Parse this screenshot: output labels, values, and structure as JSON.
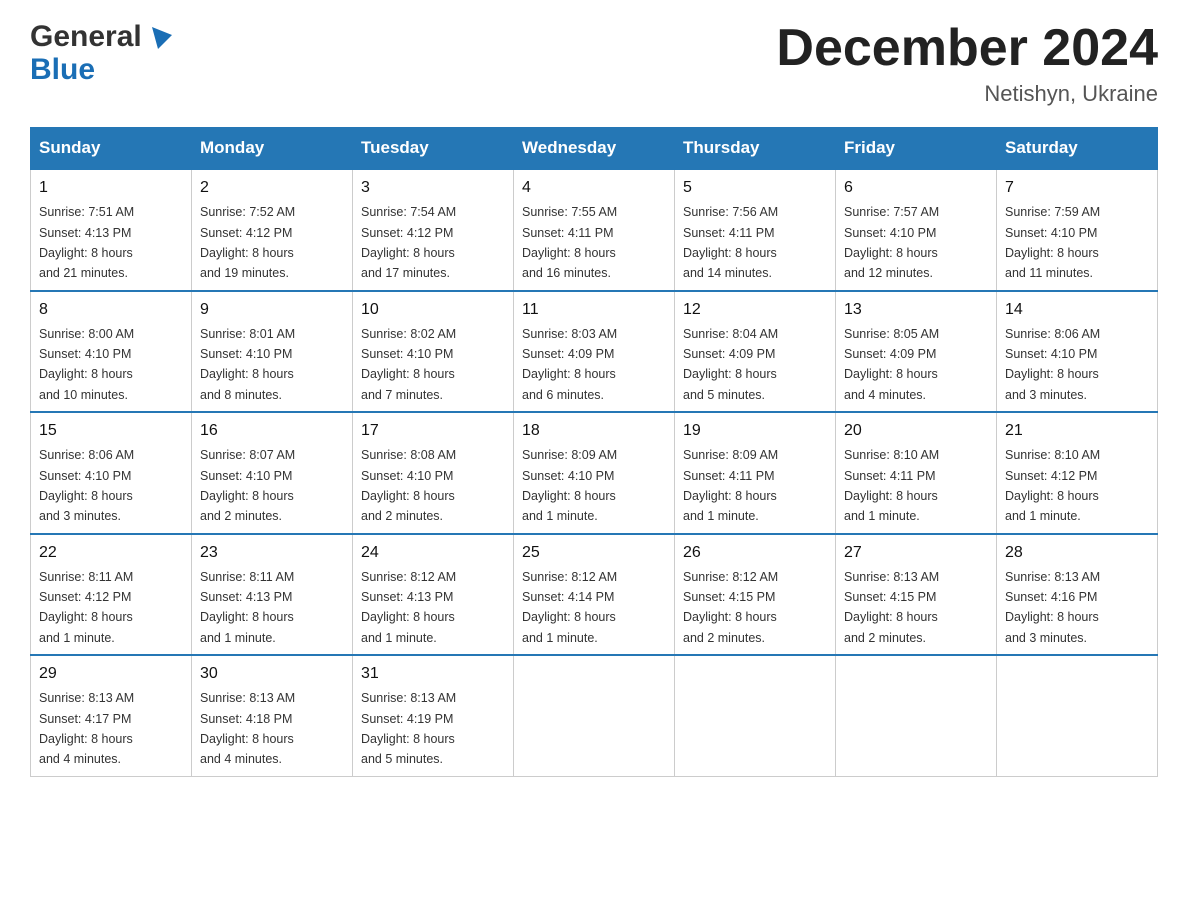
{
  "header": {
    "logo_general": "General",
    "logo_blue": "Blue",
    "month_title": "December 2024",
    "location": "Netishyn, Ukraine"
  },
  "weekdays": [
    "Sunday",
    "Monday",
    "Tuesday",
    "Wednesday",
    "Thursday",
    "Friday",
    "Saturday"
  ],
  "weeks": [
    [
      {
        "day": "1",
        "sunrise": "7:51 AM",
        "sunset": "4:13 PM",
        "daylight": "8 hours and 21 minutes."
      },
      {
        "day": "2",
        "sunrise": "7:52 AM",
        "sunset": "4:12 PM",
        "daylight": "8 hours and 19 minutes."
      },
      {
        "day": "3",
        "sunrise": "7:54 AM",
        "sunset": "4:12 PM",
        "daylight": "8 hours and 17 minutes."
      },
      {
        "day": "4",
        "sunrise": "7:55 AM",
        "sunset": "4:11 PM",
        "daylight": "8 hours and 16 minutes."
      },
      {
        "day": "5",
        "sunrise": "7:56 AM",
        "sunset": "4:11 PM",
        "daylight": "8 hours and 14 minutes."
      },
      {
        "day": "6",
        "sunrise": "7:57 AM",
        "sunset": "4:10 PM",
        "daylight": "8 hours and 12 minutes."
      },
      {
        "day": "7",
        "sunrise": "7:59 AM",
        "sunset": "4:10 PM",
        "daylight": "8 hours and 11 minutes."
      }
    ],
    [
      {
        "day": "8",
        "sunrise": "8:00 AM",
        "sunset": "4:10 PM",
        "daylight": "8 hours and 10 minutes."
      },
      {
        "day": "9",
        "sunrise": "8:01 AM",
        "sunset": "4:10 PM",
        "daylight": "8 hours and 8 minutes."
      },
      {
        "day": "10",
        "sunrise": "8:02 AM",
        "sunset": "4:10 PM",
        "daylight": "8 hours and 7 minutes."
      },
      {
        "day": "11",
        "sunrise": "8:03 AM",
        "sunset": "4:09 PM",
        "daylight": "8 hours and 6 minutes."
      },
      {
        "day": "12",
        "sunrise": "8:04 AM",
        "sunset": "4:09 PM",
        "daylight": "8 hours and 5 minutes."
      },
      {
        "day": "13",
        "sunrise": "8:05 AM",
        "sunset": "4:09 PM",
        "daylight": "8 hours and 4 minutes."
      },
      {
        "day": "14",
        "sunrise": "8:06 AM",
        "sunset": "4:10 PM",
        "daylight": "8 hours and 3 minutes."
      }
    ],
    [
      {
        "day": "15",
        "sunrise": "8:06 AM",
        "sunset": "4:10 PM",
        "daylight": "8 hours and 3 minutes."
      },
      {
        "day": "16",
        "sunrise": "8:07 AM",
        "sunset": "4:10 PM",
        "daylight": "8 hours and 2 minutes."
      },
      {
        "day": "17",
        "sunrise": "8:08 AM",
        "sunset": "4:10 PM",
        "daylight": "8 hours and 2 minutes."
      },
      {
        "day": "18",
        "sunrise": "8:09 AM",
        "sunset": "4:10 PM",
        "daylight": "8 hours and 1 minute."
      },
      {
        "day": "19",
        "sunrise": "8:09 AM",
        "sunset": "4:11 PM",
        "daylight": "8 hours and 1 minute."
      },
      {
        "day": "20",
        "sunrise": "8:10 AM",
        "sunset": "4:11 PM",
        "daylight": "8 hours and 1 minute."
      },
      {
        "day": "21",
        "sunrise": "8:10 AM",
        "sunset": "4:12 PM",
        "daylight": "8 hours and 1 minute."
      }
    ],
    [
      {
        "day": "22",
        "sunrise": "8:11 AM",
        "sunset": "4:12 PM",
        "daylight": "8 hours and 1 minute."
      },
      {
        "day": "23",
        "sunrise": "8:11 AM",
        "sunset": "4:13 PM",
        "daylight": "8 hours and 1 minute."
      },
      {
        "day": "24",
        "sunrise": "8:12 AM",
        "sunset": "4:13 PM",
        "daylight": "8 hours and 1 minute."
      },
      {
        "day": "25",
        "sunrise": "8:12 AM",
        "sunset": "4:14 PM",
        "daylight": "8 hours and 1 minute."
      },
      {
        "day": "26",
        "sunrise": "8:12 AM",
        "sunset": "4:15 PM",
        "daylight": "8 hours and 2 minutes."
      },
      {
        "day": "27",
        "sunrise": "8:13 AM",
        "sunset": "4:15 PM",
        "daylight": "8 hours and 2 minutes."
      },
      {
        "day": "28",
        "sunrise": "8:13 AM",
        "sunset": "4:16 PM",
        "daylight": "8 hours and 3 minutes."
      }
    ],
    [
      {
        "day": "29",
        "sunrise": "8:13 AM",
        "sunset": "4:17 PM",
        "daylight": "8 hours and 4 minutes."
      },
      {
        "day": "30",
        "sunrise": "8:13 AM",
        "sunset": "4:18 PM",
        "daylight": "8 hours and 4 minutes."
      },
      {
        "day": "31",
        "sunrise": "8:13 AM",
        "sunset": "4:19 PM",
        "daylight": "8 hours and 5 minutes."
      },
      null,
      null,
      null,
      null
    ]
  ],
  "labels": {
    "sunrise": "Sunrise:",
    "sunset": "Sunset:",
    "daylight": "Daylight:"
  }
}
